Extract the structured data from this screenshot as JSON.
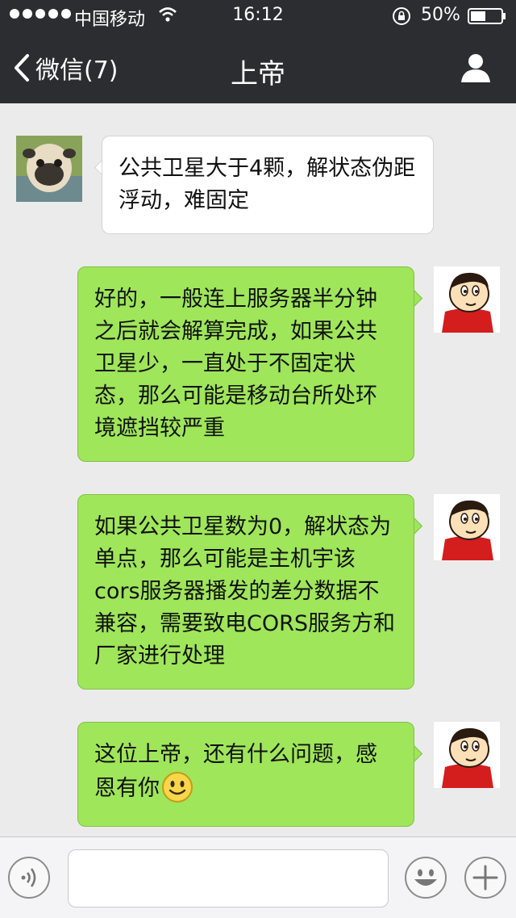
{
  "status_bar": {
    "carrier": "中国移动",
    "time": "16:12",
    "battery": "50%"
  },
  "nav": {
    "back_label": "微信(7)",
    "title": "上帝"
  },
  "messages": [
    {
      "direction": "incoming",
      "sender": "contact",
      "text": "公共卫星大于4颗，解状态伪距浮动，难固定"
    },
    {
      "direction": "outgoing",
      "sender": "me",
      "text": "好的，一般连上服务器半分钟之后就会解算完成，如果公共卫星少，一直处于不固定状态，那么可能是移动台所处环境遮挡较严重"
    },
    {
      "direction": "outgoing",
      "sender": "me",
      "text": "如果公共卫星数为0，解状态为单点，那么可能是主机宇该cors服务器播发的差分数据不兼容，需要致电CORS服务方和厂家进行处理"
    },
    {
      "direction": "outgoing",
      "sender": "me",
      "text": "这位上帝，还有什么问题，感恩有你",
      "emoji": "smile-emoji"
    }
  ],
  "input_bar": {
    "input_value": "",
    "icons": [
      "voice-icon",
      "emoji-icon",
      "plus-icon"
    ]
  },
  "colors": {
    "header_bg": "#2c2d31",
    "chat_bg": "#ebebeb",
    "outgoing_bubble": "#9fe65a",
    "incoming_bubble": "#ffffff"
  }
}
